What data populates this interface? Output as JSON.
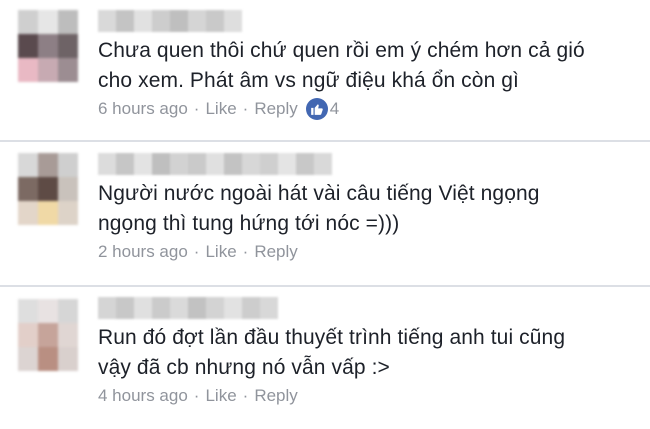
{
  "comments": [
    {
      "text_line1": "Chưa quen thôi chứ quen rồi em ý chém hơn cả gió",
      "text_line2": "cho xem. Phát âm vs ngữ điệu khá ổn còn gì",
      "time": "6 hours ago",
      "like_label": "Like",
      "reply_label": "Reply",
      "reaction_count": "4"
    },
    {
      "text_line1": "Người nước ngoài hát vài câu tiếng Việt ngọng",
      "text_line2": "ngọng thì tung hứng tới nóc =)))",
      "time": "2 hours ago",
      "like_label": "Like",
      "reply_label": "Reply"
    },
    {
      "text_line1": "Run đó đợt lần đầu thuyết trình tiếng anh tui cũng",
      "text_line2": "vậy đã cb nhưng nó vẫn vấp :>",
      "time": "4 hours ago",
      "like_label": "Like",
      "reply_label": "Reply"
    }
  ],
  "separator": "·",
  "icons": {
    "avatar": "pixelated-avatar",
    "reaction": "thumbs-up-icon"
  },
  "colors": {
    "text": "#1d2129",
    "meta": "#90949c",
    "like_badge": "#4267b2",
    "divider": "#dcdfe5"
  }
}
